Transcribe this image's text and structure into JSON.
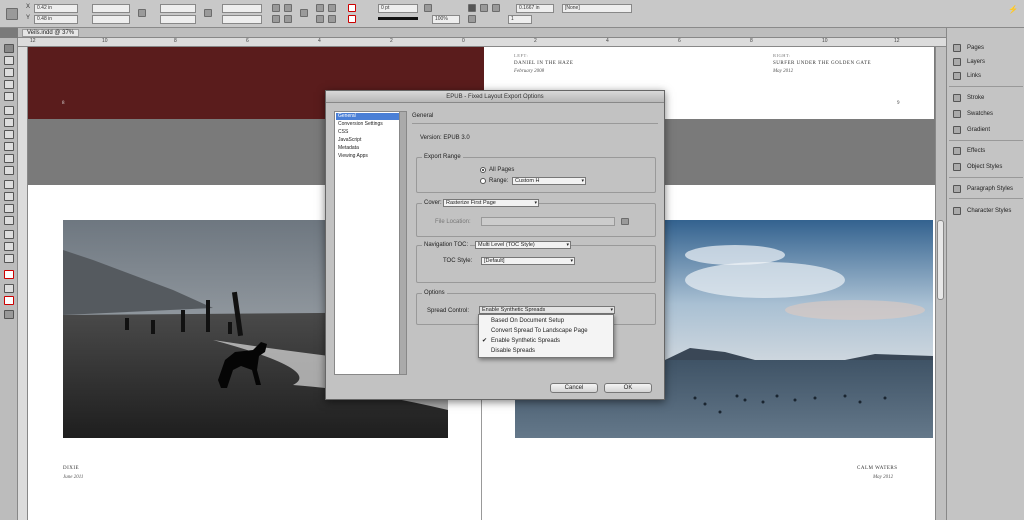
{
  "app": {
    "doc_tab": "Veils.indd @ 37%"
  },
  "control_bar": {
    "x_value": "0.42 in",
    "y_value": "0.48 in",
    "stroke_weight": "0 pt",
    "zoom_value": "100%",
    "width_value": "0.1667 in",
    "style_value": "[None]",
    "ref_point": "1"
  },
  "ruler": {
    "ticks": [
      "12",
      "10",
      "8",
      "6",
      "4",
      "2",
      "0",
      "2",
      "4",
      "6",
      "8",
      "10",
      "12"
    ]
  },
  "pages": {
    "spread_top_right": {
      "left_label": "LEFT:",
      "left_title": "DANIEL IN THE HAZE",
      "left_date": "February 2008",
      "right_label": "RIGHT:",
      "right_title": "SURFER UNDER THE GOLDEN GATE",
      "right_date": "May 2012",
      "page_num_left": "8",
      "page_num_right": "9"
    },
    "spread_bottom": {
      "left_title": "DIXIE",
      "left_date": "June 2011",
      "right_title": "CALM WATERS",
      "right_date": "May 2012"
    }
  },
  "dialog": {
    "title": "EPUB - Fixed Layout Export Options",
    "nav": [
      "General",
      "Conversion Settings",
      "CSS",
      "JavaScript",
      "Metadata",
      "Viewing Apps"
    ],
    "section_title": "General",
    "version": "Version: EPUB 3.0",
    "export_range": {
      "label": "Export Range",
      "all_pages": "All Pages",
      "range": "Range:",
      "range_value": "Custom H"
    },
    "cover": {
      "label": "Cover:",
      "value": "Rasterize First Page",
      "file_location": "File Location:"
    },
    "nav_toc": {
      "label": "Navigation TOC:",
      "value": "Multi Level (TOC Style)",
      "toc_style_label": "TOC Style:",
      "toc_style_value": "[Default]"
    },
    "options": {
      "label": "Options",
      "spread_control_label": "Spread Control:",
      "spread_control_value": "Enable Synthetic Spreads"
    },
    "menu": [
      "Based On Document Setup",
      "Convert Spread To Landscape Page",
      "Enable Synthetic Spreads",
      "Disable Spreads"
    ],
    "menu_checked": "✔",
    "cancel": "Cancel",
    "ok": "OK"
  },
  "panels": {
    "items": [
      "Pages",
      "Layers",
      "Links",
      "Stroke",
      "Swatches",
      "Gradient",
      "Effects",
      "Object Styles",
      "Paragraph Styles",
      "Character Styles"
    ]
  },
  "colors": {
    "accent": "#4a7fd6",
    "burgundy": "#5a1c1c"
  }
}
